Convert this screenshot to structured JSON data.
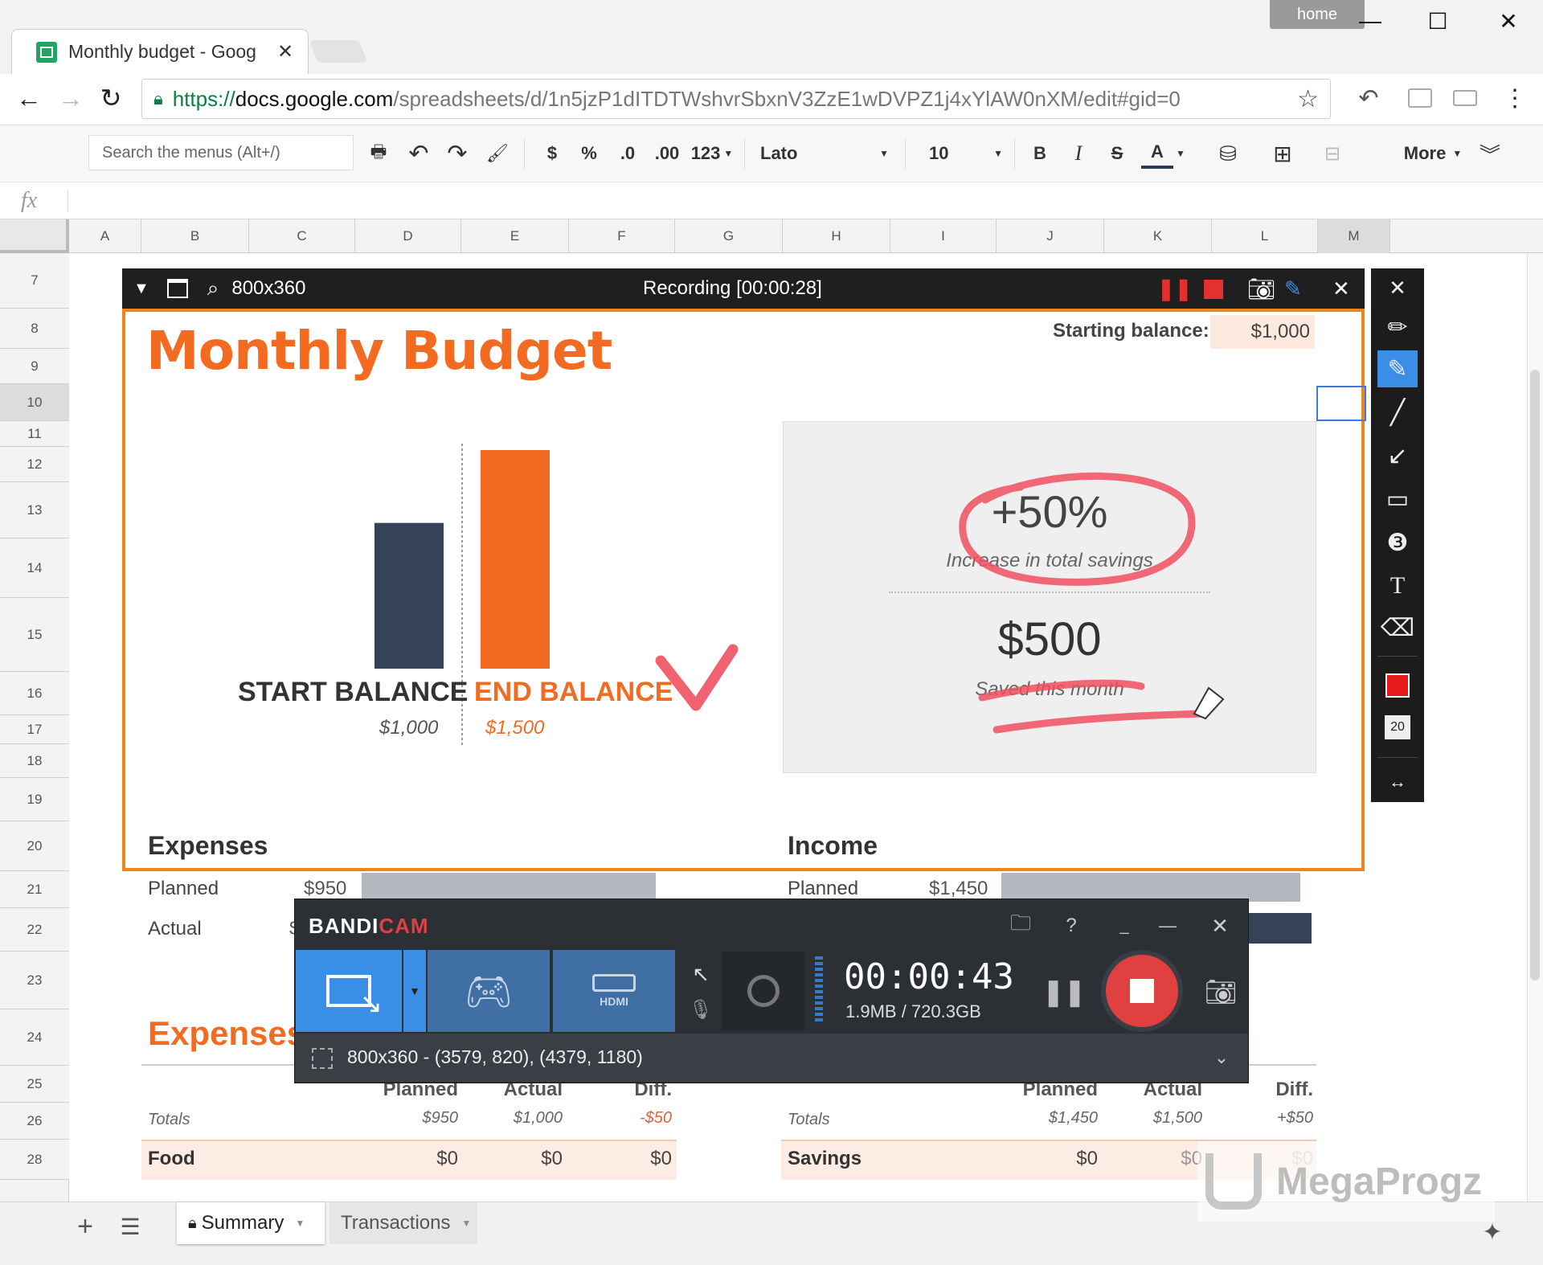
{
  "browser": {
    "tab_title": "Monthly budget - Goog",
    "url_prefix": "https://",
    "url_host": "docs.google.com",
    "url_path": "/spreadsheets/d/1n5jzP1dITDTWshvrSbxnV3ZzE1wDVPZ1j4xYlAW0nXM/edit#gid=0",
    "profile_badge": "home"
  },
  "sheets_toolbar": {
    "search_placeholder": "Search the menus (Alt+/)",
    "currency": "$",
    "percent": "%",
    "dec_less": ".0",
    "dec_more": ".00",
    "number_format": "123",
    "font": "Lato",
    "font_size": "10",
    "bold": "B",
    "italic": "I",
    "strike": "S",
    "text_color": "A",
    "more": "More",
    "fx": "fx"
  },
  "columns": [
    "A",
    "B",
    "C",
    "D",
    "E",
    "F",
    "G",
    "H",
    "I",
    "J",
    "K",
    "L",
    "M"
  ],
  "rows": [
    "7",
    "8",
    "9",
    "10",
    "11",
    "12",
    "13",
    "14",
    "15",
    "16",
    "17",
    "18",
    "19",
    "20",
    "21",
    "22",
    "23",
    "24",
    "25",
    "26",
    "28"
  ],
  "recorder_bar": {
    "size": "800x360",
    "status": "Recording [00:00:28]"
  },
  "budget": {
    "title": "Monthly Budget",
    "starting_balance_label": "Starting balance:",
    "starting_balance_value": "$1,000",
    "start_balance_label": "START BALANCE",
    "start_balance_value": "$1,000",
    "end_balance_label": "END BALANCE",
    "end_balance_value": "$1,500",
    "savings_pct": "+50%",
    "savings_pct_caption": "Increase in total savings",
    "saved_amount": "$500",
    "saved_caption": "Saved this month",
    "expenses_heading": "Expenses",
    "income_heading": "Income",
    "planned_label": "Planned",
    "actual_label": "Actual",
    "expenses_planned": "$950",
    "income_planned": "$1,450",
    "expenses_actual_partial": "$"
  },
  "chart_data": {
    "type": "bar",
    "categories": [
      "START BALANCE",
      "END BALANCE"
    ],
    "values": [
      1000,
      1500
    ],
    "title": "",
    "xlabel": "",
    "ylabel": "",
    "ylim": [
      0,
      1500
    ],
    "colors": [
      "#34425a",
      "#f26b21"
    ]
  },
  "lower_table": {
    "heading": "Expenses",
    "col_planned": "Planned",
    "col_actual": "Actual",
    "col_diff": "Diff.",
    "totals_label": "Totals",
    "exp_totals": [
      "$950",
      "$1,000",
      "-$50"
    ],
    "inc_totals": [
      "$1,450",
      "$1,500",
      "+$50"
    ],
    "exp_row_label": "Food",
    "exp_row_values": [
      "$0",
      "$0",
      "$0"
    ],
    "inc_row_label": "Savings",
    "inc_row_values": [
      "$0",
      "$0",
      "$0"
    ]
  },
  "drawing_tools": {
    "size_value": "20",
    "text_tool": "T",
    "color": "#e81b1b"
  },
  "bandicam": {
    "logo_left": "BANDI",
    "logo_right": "CAM",
    "help": "?",
    "timer": "00:00:43",
    "storage": "1.9MB / 720.3GB",
    "region": "800x360 - (3579, 820), (4379, 1180)",
    "hdmi_label": "HDMI"
  },
  "sheet_tabs": [
    "Summary",
    "Transactions"
  ],
  "watermark": "MegaProgz",
  "colors": {
    "orange": "#f26b21",
    "navy": "#34425a",
    "recording_border": "#f08519",
    "bandicam_blue": "#3a8ee6",
    "stop_red": "#e14040",
    "pen_red": "#f05060"
  }
}
